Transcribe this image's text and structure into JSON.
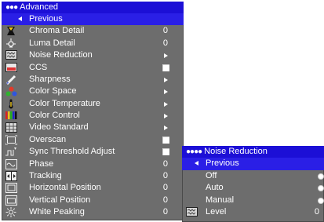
{
  "main_menu": {
    "title": "Advanced",
    "items": [
      {
        "label": "Previous",
        "icon": "back-arrow-icon",
        "control": "back",
        "selected": true
      },
      {
        "label": "Chroma Detail",
        "icon": "chroma-icon",
        "control": "value",
        "value": "0"
      },
      {
        "label": "Luma Detail",
        "icon": "luma-icon",
        "control": "value",
        "value": "0"
      },
      {
        "label": "Noise Reduction",
        "icon": "noise-icon",
        "control": "submenu"
      },
      {
        "label": "CCS",
        "icon": "ccs-icon",
        "control": "checkbox"
      },
      {
        "label": "Sharpness",
        "icon": "pen-icon",
        "control": "submenu"
      },
      {
        "label": "Color Space",
        "icon": "color-space-icon",
        "control": "submenu"
      },
      {
        "label": "Color Temperature",
        "icon": "thermometer-icon",
        "control": "submenu"
      },
      {
        "label": "Color Control",
        "icon": "color-bars-icon",
        "control": "submenu"
      },
      {
        "label": "Video Standard",
        "icon": "video-standard-icon",
        "control": "submenu"
      },
      {
        "label": "Overscan",
        "icon": "overscan-icon",
        "control": "checkbox"
      },
      {
        "label": "Sync Threshold Adjust",
        "icon": "sync-icon",
        "control": "checkbox"
      },
      {
        "label": "Phase",
        "icon": "phase-icon",
        "control": "value",
        "value": "0"
      },
      {
        "label": "Tracking",
        "icon": "tracking-icon",
        "control": "value",
        "value": "0"
      },
      {
        "label": "Horizontal Position",
        "icon": "horizontal-position-icon",
        "control": "value",
        "value": "0"
      },
      {
        "label": "Vertical Position",
        "icon": "vertical-position-icon",
        "control": "value",
        "value": "0"
      },
      {
        "label": "White Peaking",
        "icon": "sun-icon",
        "control": "value",
        "value": "0"
      }
    ]
  },
  "sub_menu": {
    "title": "Noise Reduction",
    "items": [
      {
        "label": "Previous",
        "control": "back",
        "selected": true
      },
      {
        "label": "Off",
        "control": "radio"
      },
      {
        "label": "Auto",
        "control": "radio"
      },
      {
        "label": "Manual",
        "control": "radio"
      },
      {
        "label": "Level",
        "icon": "noise-level-icon",
        "control": "value",
        "value": "0"
      }
    ]
  },
  "colors": {
    "menu_bg": "#6d6d6d",
    "title_bg": "#1c0fd6",
    "highlight_bg": "#2a1fe6",
    "text": "#ffffff"
  }
}
